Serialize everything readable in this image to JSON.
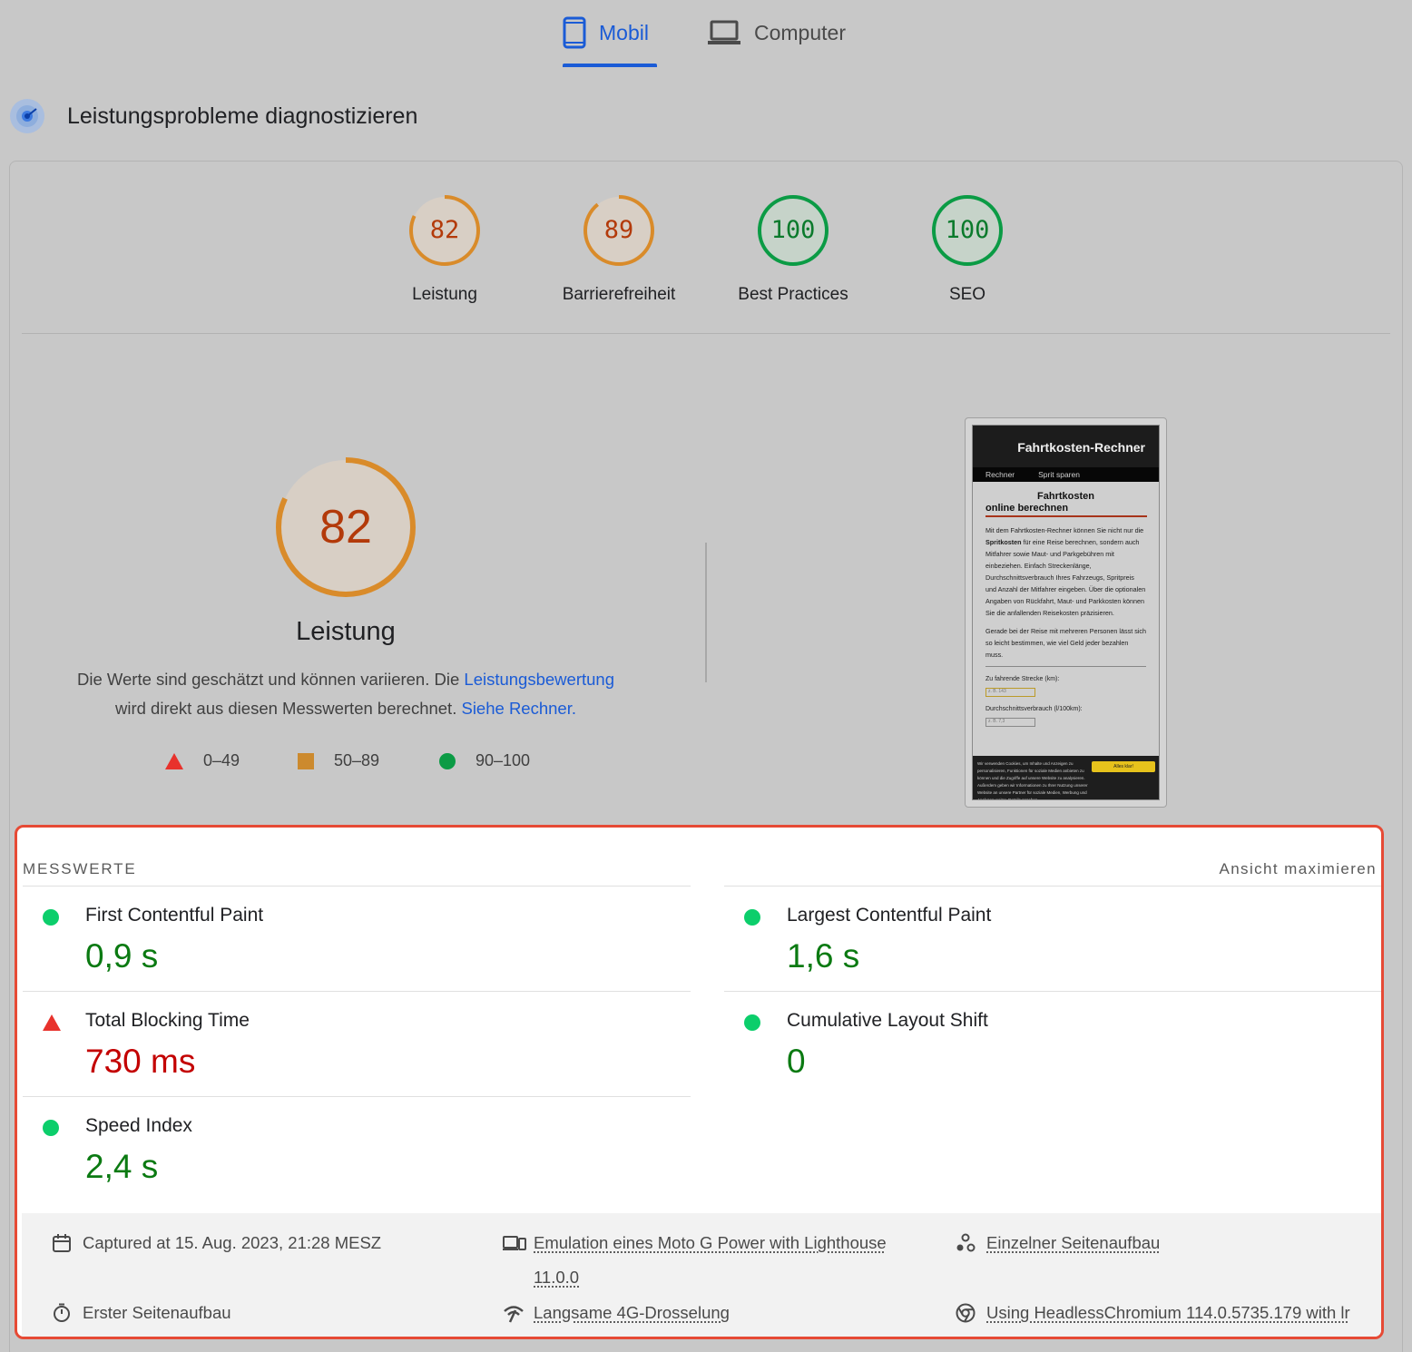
{
  "tabs": [
    {
      "label": "Mobil",
      "active": true
    },
    {
      "label": "Computer",
      "active": false
    }
  ],
  "section_title": "Leistungsprobleme diagnostizieren",
  "scores": [
    {
      "label": "Leistung",
      "value": "82",
      "fraction": 0.82,
      "status": "average",
      "color": "#d98b2a"
    },
    {
      "label": "Barrierefreiheit",
      "value": "89",
      "fraction": 0.89,
      "status": "average",
      "color": "#d98b2a"
    },
    {
      "label": "Best Practices",
      "value": "100",
      "fraction": 1.0,
      "status": "pass",
      "color": "#0b9b45"
    },
    {
      "label": "SEO",
      "value": "100",
      "fraction": 1.0,
      "status": "pass",
      "color": "#0b9b45"
    }
  ],
  "performance": {
    "value": "82",
    "fraction": 0.82,
    "title": "Leistung",
    "desc_part1": "Die Werte sind geschätzt und können variieren. Die ",
    "desc_link1": "Leistungsbewertung",
    "desc_part2": " wird direkt aus diesen Messwerten berechnet. ",
    "desc_link2": "Siehe Rechner."
  },
  "legend": [
    {
      "range": "0–49",
      "shape": "triangle",
      "color": "#e8322c"
    },
    {
      "range": "50–89",
      "shape": "square",
      "color": "#cc8a2e"
    },
    {
      "range": "90–100",
      "shape": "circle",
      "color": "#0b9b45"
    }
  ],
  "thumbnail": {
    "site_title": "Fahrtkosten-Rechner",
    "nav": [
      "Rechner",
      "Sprit sparen"
    ],
    "heading_line1": "Fahrtkosten",
    "heading_line2": "online berechnen",
    "para1_a": "Mit dem Fahrtkosten-Rechner können Sie nicht nur die ",
    "para1_b": "Spritkosten",
    "para1_c": " für eine Reise berechnen, sondern auch Mitfahrer sowie Maut- und Parkgebühren mit einbeziehen. Einfach Streckenlänge, Durchschnittsverbrauch Ihres Fahrzeugs, Spritpreis und Anzahl der Mitfahrer eingeben. Über die optionalen Angaben von Rückfahrt, Maut- und Parkkosten können Sie die anfallenden Reisekosten präzisieren.",
    "para2": "Gerade bei der Reise mit mehreren Personen lässt sich so leicht bestimmen, wie viel Geld jeder bezahlen muss.",
    "field1_label": "Zu fahrende Strecke (km):",
    "field1_placeholder": "z. B. 143",
    "field2_label": "Durchschnittsverbrauch (l/100km):",
    "field2_placeholder": "z. B. 7,3",
    "cookie_text": "Wir verwenden Cookies, um Inhalte und Anzeigen zu personalisieren, Funktionen für soziale Medien anbieten zu können und die Zugriffe auf unsere Website zu analysieren. Außerdem geben wir Informationen zu Ihrer Nutzung unserer Website an unsere Partner für soziale Medien, Werbung und Analysen weiter. Details ansehen",
    "cookie_button": "Alles klar!"
  },
  "metrics": {
    "header": "MESSWERTE",
    "expand": "Ansicht maximieren",
    "items": [
      {
        "name": "First Contentful Paint",
        "value": "0,9 s",
        "status": "pass"
      },
      {
        "name": "Largest Contentful Paint",
        "value": "1,6 s",
        "status": "pass"
      },
      {
        "name": "Total Blocking Time",
        "value": "730 ms",
        "status": "fail"
      },
      {
        "name": "Cumulative Layout Shift",
        "value": "0",
        "status": "pass"
      },
      {
        "name": "Speed Index",
        "value": "2,4 s",
        "status": "pass"
      }
    ]
  },
  "footer": {
    "captured": "Captured at 15. Aug. 2023, 21:28 MESZ",
    "emulation_line1": "Emulation eines Moto G Power with Lighthouse",
    "emulation_line2": "11.0.0",
    "single_load": "Einzelner Seitenaufbau",
    "initial_load": "Erster Seitenaufbau",
    "throttling": "Langsame 4G-Drosselung",
    "browser": "Using HeadlessChromium 114.0.5735.179 with lr"
  }
}
